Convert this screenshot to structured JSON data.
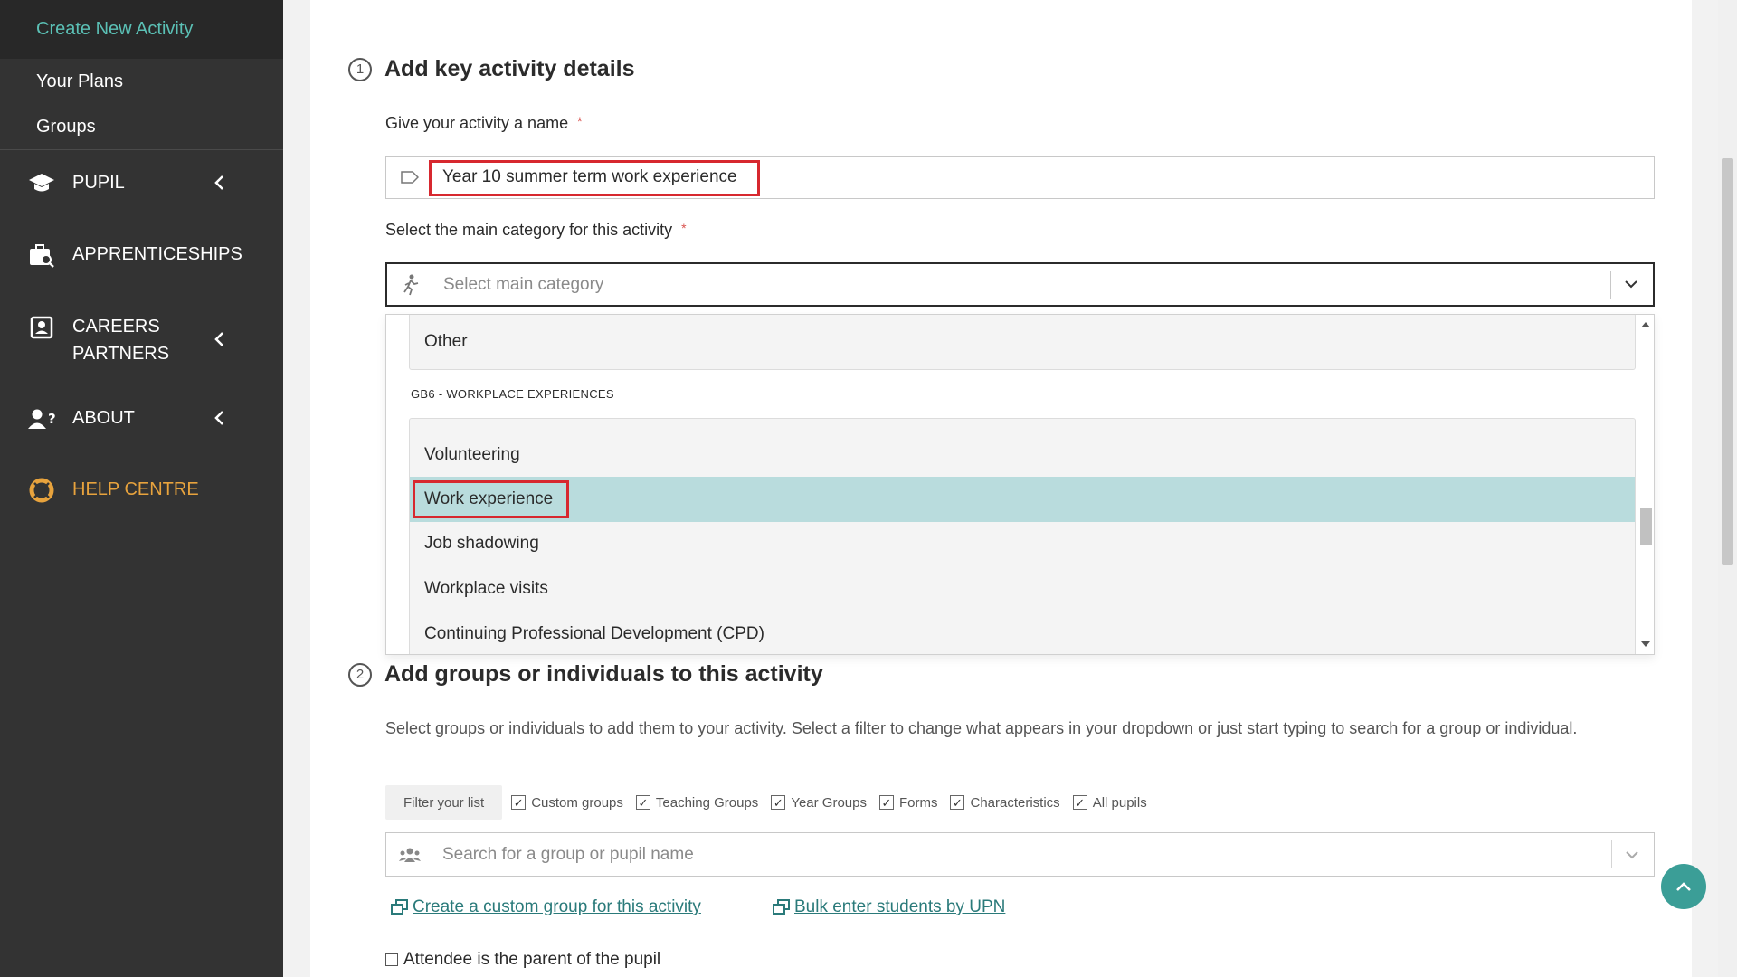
{
  "sidebar": {
    "sub_items": [
      "Create New Activity",
      "Your Plans",
      "Groups"
    ],
    "nav": [
      {
        "label_lines": [
          "PUPIL"
        ],
        "icon": "graduation-cap-icon"
      },
      {
        "label_lines": [
          "APPRENTICESHIPS"
        ],
        "icon": "briefcase-search-icon"
      },
      {
        "label_lines": [
          "CAREERS",
          "PARTNERS"
        ],
        "icon": "contact-card-icon"
      },
      {
        "label_lines": [
          "ABOUT"
        ],
        "icon": "user-question-icon"
      },
      {
        "label_lines": [
          "HELP CENTRE"
        ],
        "icon": "lifebuoy-icon"
      }
    ]
  },
  "step1": {
    "number": "1",
    "title": "Add key activity details"
  },
  "name_field": {
    "label": "Give your activity a name",
    "required_mark": "*",
    "value": "Year 10 summer term work experience"
  },
  "category_field": {
    "label": "Select the main category for this activity",
    "required_mark": "*",
    "placeholder": "Select main category"
  },
  "dropdown": {
    "first_group_options": [
      "Other"
    ],
    "group_header": "GB6 - WORKPLACE EXPERIENCES",
    "group_options": [
      "Volunteering",
      "Work experience",
      "Job shadowing",
      "Workplace visits",
      "Continuing Professional Development (CPD)"
    ],
    "selected": "Work experience"
  },
  "step2": {
    "number": "2",
    "title": "Add groups or individuals to this activity"
  },
  "step2_description": "Select groups or individuals to add them to your activity. Select a filter to change what appears in your dropdown or just start typing to search for a group or individual.",
  "filter": {
    "button_label": "Filter your list",
    "checkboxes": [
      "Custom groups",
      "Teaching Groups",
      "Year Groups",
      "Forms",
      "Characteristics",
      "All pupils"
    ],
    "check_mark": "✓"
  },
  "search_field": {
    "placeholder": "Search for a group or pupil name"
  },
  "links": {
    "custom_group": "Create a custom group for this activity",
    "bulk_upn": "Bulk enter students by UPN"
  },
  "attendee_label": "Attendee is the parent of the pupil",
  "colors": {
    "accent": "#5bc0b5",
    "help": "#e8a33d",
    "highlight": "#d7282f",
    "selected_option": "#b9dcdd",
    "fab": "#3b9e97"
  }
}
